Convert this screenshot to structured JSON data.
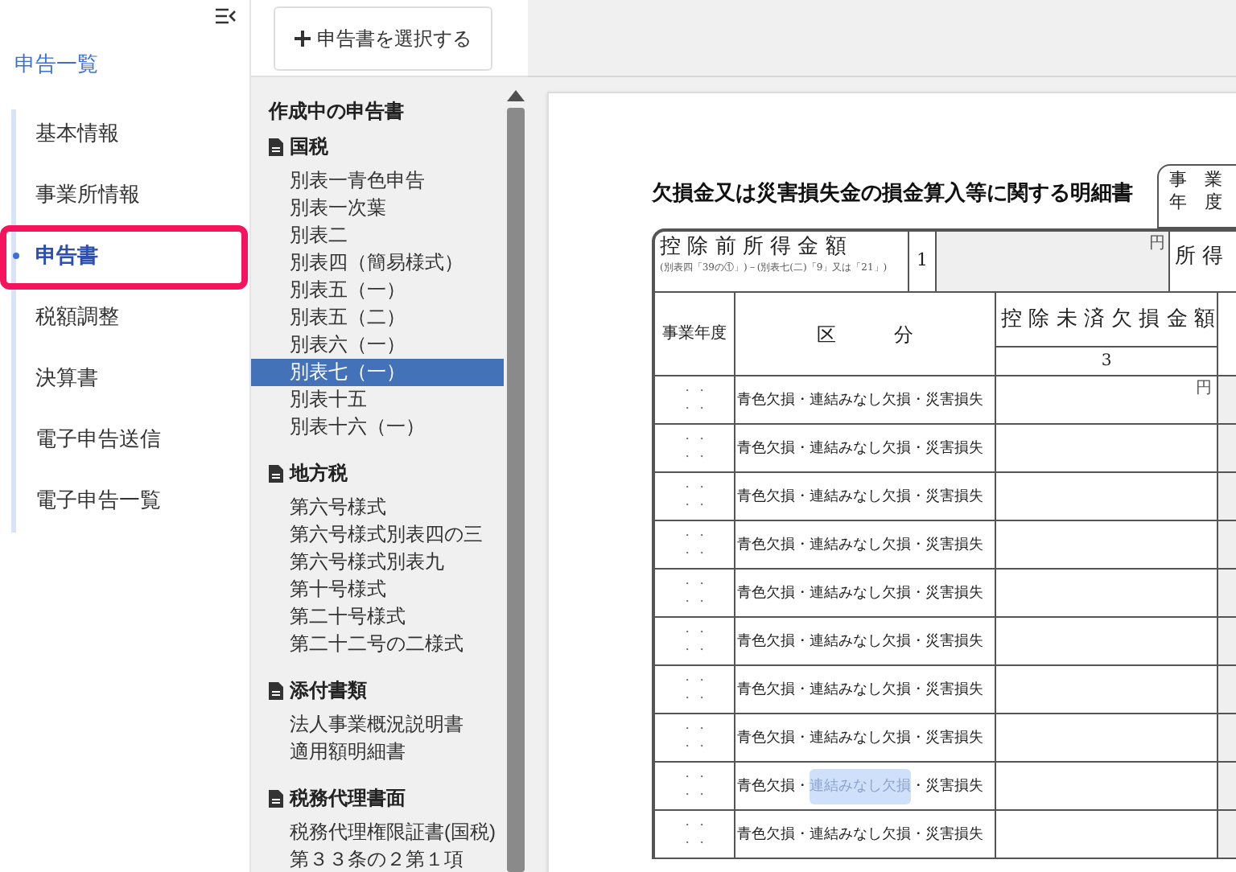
{
  "sidebar": {
    "title": "申告一覧",
    "items": [
      {
        "label": "基本情報",
        "selected": false,
        "outlined": false
      },
      {
        "label": "事業所情報",
        "selected": false,
        "outlined": false
      },
      {
        "label": "申告書",
        "selected": true,
        "outlined": true
      },
      {
        "label": "税額調整",
        "selected": false,
        "outlined": false
      },
      {
        "label": "決算書",
        "selected": false,
        "outlined": false
      },
      {
        "label": "電子申告送信",
        "selected": false,
        "outlined": false
      },
      {
        "label": "電子申告一覧",
        "selected": false,
        "outlined": false
      }
    ]
  },
  "toolbar": {
    "select_button": "申告書を選択する"
  },
  "form_tree": {
    "heading": "作成中の申告書",
    "groups": [
      {
        "label": "国税",
        "children": [
          {
            "label": "別表一青色申告",
            "selected": false
          },
          {
            "label": "別表一次葉",
            "selected": false
          },
          {
            "label": "別表二",
            "selected": false
          },
          {
            "label": "別表四（簡易様式）",
            "selected": false
          },
          {
            "label": "別表五（一）",
            "selected": false
          },
          {
            "label": "別表五（二）",
            "selected": false
          },
          {
            "label": "別表六（一）",
            "selected": false
          },
          {
            "label": "別表七（一）",
            "selected": true
          },
          {
            "label": "別表十五",
            "selected": false
          },
          {
            "label": "別表十六（一）",
            "selected": false
          }
        ]
      },
      {
        "label": "地方税",
        "children": [
          {
            "label": "第六号様式",
            "selected": false
          },
          {
            "label": "第六号様式別表四の三",
            "selected": false
          },
          {
            "label": "第六号様式別表九",
            "selected": false
          },
          {
            "label": "第十号様式",
            "selected": false
          },
          {
            "label": "第二十号様式",
            "selected": false
          },
          {
            "label": "第二十二号の二様式",
            "selected": false
          }
        ]
      },
      {
        "label": "添付書類",
        "children": [
          {
            "label": "法人事業概況説明書",
            "selected": false
          },
          {
            "label": "適用額明細書",
            "selected": false
          }
        ]
      },
      {
        "label": "税務代理書面",
        "children": [
          {
            "label": "税務代理権限証書(国税)",
            "selected": false
          },
          {
            "label": "第３３条の２第１項",
            "selected": false
          }
        ]
      }
    ]
  },
  "document": {
    "title": "欠損金又は災害損失金の損金算入等に関する明細書",
    "period_box": [
      "事　業",
      "年　度"
    ],
    "deduction_row": {
      "label": "控 除 前 所 得 金 額",
      "note": "(別表四「39の①」)－(別表七(二)「9」又は「21」)",
      "number": "1",
      "unit": "円"
    },
    "income_label": "所 得",
    "columns": {
      "period": "事業年度",
      "category": "区　　　分",
      "remaining": "控 除 未 済 欠 損 金 額",
      "remaining_number": "3"
    },
    "rows": [
      {
        "period": [
          "・ ・",
          "・ ・"
        ],
        "unit": "円",
        "options": [
          {
            "label": "青色欠損・",
            "selected": false
          },
          {
            "label": "連結みなし欠損",
            "selected": false
          },
          {
            "label": "・災害損失",
            "selected": false
          }
        ]
      },
      {
        "period": [
          "・ ・",
          "・ ・"
        ],
        "options": [
          {
            "label": "青色欠損・",
            "selected": false
          },
          {
            "label": "連結みなし欠損",
            "selected": false
          },
          {
            "label": "・災害損失",
            "selected": false
          }
        ]
      },
      {
        "period": [
          "・ ・",
          "・ ・"
        ],
        "options": [
          {
            "label": "青色欠損・",
            "selected": false
          },
          {
            "label": "連結みなし欠損",
            "selected": false
          },
          {
            "label": "・災害損失",
            "selected": false
          }
        ]
      },
      {
        "period": [
          "・ ・",
          "・ ・"
        ],
        "options": [
          {
            "label": "青色欠損・",
            "selected": false
          },
          {
            "label": "連結みなし欠損",
            "selected": false
          },
          {
            "label": "・災害損失",
            "selected": false
          }
        ]
      },
      {
        "period": [
          "・ ・",
          "・ ・"
        ],
        "options": [
          {
            "label": "青色欠損・",
            "selected": false
          },
          {
            "label": "連結みなし欠損",
            "selected": false
          },
          {
            "label": "・災害損失",
            "selected": false
          }
        ]
      },
      {
        "period": [
          "・ ・",
          "・ ・"
        ],
        "options": [
          {
            "label": "青色欠損・",
            "selected": false
          },
          {
            "label": "連結みなし欠損",
            "selected": false
          },
          {
            "label": "・災害損失",
            "selected": false
          }
        ]
      },
      {
        "period": [
          "・ ・",
          "・ ・"
        ],
        "options": [
          {
            "label": "青色欠損・",
            "selected": false
          },
          {
            "label": "連結みなし欠損",
            "selected": false
          },
          {
            "label": "・災害損失",
            "selected": false
          }
        ]
      },
      {
        "period": [
          "・ ・",
          "・ ・"
        ],
        "options": [
          {
            "label": "青色欠損・",
            "selected": false
          },
          {
            "label": "連結みなし欠損",
            "selected": false
          },
          {
            "label": "・災害損失",
            "selected": false
          }
        ]
      },
      {
        "period": [
          "・ ・",
          "・ ・"
        ],
        "options": [
          {
            "label": "青色欠損・",
            "selected": false
          },
          {
            "label": "連結みなし欠損",
            "selected": true
          },
          {
            "label": "・災害損失",
            "selected": false
          }
        ]
      },
      {
        "period": [
          "・ ・",
          "・ ・"
        ],
        "options": [
          {
            "label": "青色欠損・",
            "selected": false
          },
          {
            "label": "連結みなし欠損",
            "selected": false
          },
          {
            "label": "・災害損失",
            "selected": false
          }
        ]
      }
    ]
  }
}
